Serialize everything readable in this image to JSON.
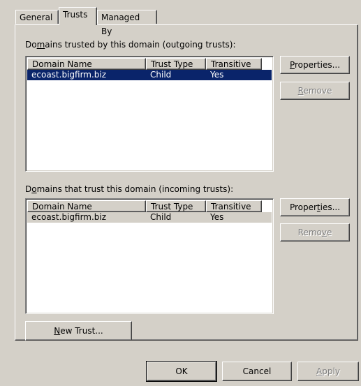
{
  "tabs": [
    {
      "label": "General"
    },
    {
      "label": "Trusts"
    },
    {
      "label": "Managed By"
    }
  ],
  "outgoing": {
    "label_pre": "Do",
    "label_ul": "m",
    "label_post": "ains trusted by this domain (outgoing trusts):",
    "columns": [
      "Domain Name",
      "Trust Type",
      "Transitive"
    ],
    "rows": [
      {
        "name": "ecoast.bigfirm.biz",
        "type": "Child",
        "transitive": "Yes",
        "selected": true
      }
    ],
    "properties_pre": "",
    "properties_ul": "P",
    "properties_post": "roperties...",
    "remove_pre": "",
    "remove_ul": "R",
    "remove_post": "emove"
  },
  "incoming": {
    "label_pre": "D",
    "label_ul": "o",
    "label_post": "mains that trust this domain (incoming trusts):",
    "columns": [
      "Domain Name",
      "Trust Type",
      "Transitive"
    ],
    "rows": [
      {
        "name": "ecoast.bigfirm.biz",
        "type": "Child",
        "transitive": "Yes",
        "selected": false
      }
    ],
    "properties_pre": "Proper",
    "properties_ul": "t",
    "properties_post": "ies...",
    "remove_pre": "Remo",
    "remove_ul": "v",
    "remove_post": "e"
  },
  "new_trust": {
    "pre": "",
    "ul": "N",
    "post": "ew Trust..."
  },
  "dialog": {
    "ok": "OK",
    "cancel": "Cancel",
    "apply_pre": "",
    "apply_ul": "A",
    "apply_post": "pply"
  }
}
